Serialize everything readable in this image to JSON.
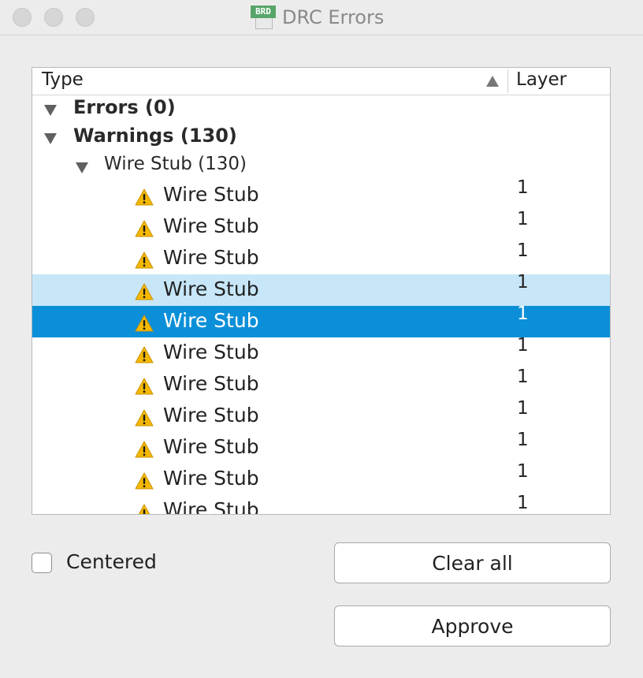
{
  "window": {
    "title": "DRC Errors",
    "icon": "brd-file-icon",
    "icon_tag": "BRD"
  },
  "table": {
    "columns": {
      "type": "Type",
      "layer": "Layer"
    },
    "sort": {
      "column": "type",
      "direction": "ascending"
    },
    "groups": [
      {
        "label": "Errors (0)",
        "expanded": true
      },
      {
        "label": "Warnings (130)",
        "expanded": true
      }
    ],
    "subgroup": {
      "label": "Wire Stub (130)",
      "expanded": true
    },
    "items": [
      {
        "label": "Wire Stub",
        "layer": "1",
        "state": "normal"
      },
      {
        "label": "Wire Stub",
        "layer": "1",
        "state": "normal"
      },
      {
        "label": "Wire Stub",
        "layer": "1",
        "state": "normal"
      },
      {
        "label": "Wire Stub",
        "layer": "1",
        "state": "hover"
      },
      {
        "label": "Wire Stub",
        "layer": "1",
        "state": "selected"
      },
      {
        "label": "Wire Stub",
        "layer": "1",
        "state": "normal"
      },
      {
        "label": "Wire Stub",
        "layer": "1",
        "state": "normal"
      },
      {
        "label": "Wire Stub",
        "layer": "1",
        "state": "normal"
      },
      {
        "label": "Wire Stub",
        "layer": "1",
        "state": "normal"
      },
      {
        "label": "Wire Stub",
        "layer": "1",
        "state": "normal"
      },
      {
        "label": "Wire Stub",
        "layer": "1",
        "state": "normal"
      }
    ]
  },
  "controls": {
    "centered_label": "Centered",
    "centered_checked": false,
    "clear_all_label": "Clear all",
    "approve_label": "Approve"
  },
  "colors": {
    "selected_row": "#0b8fd8",
    "hover_row": "#c7e7f9",
    "warning": "#f5b800"
  }
}
